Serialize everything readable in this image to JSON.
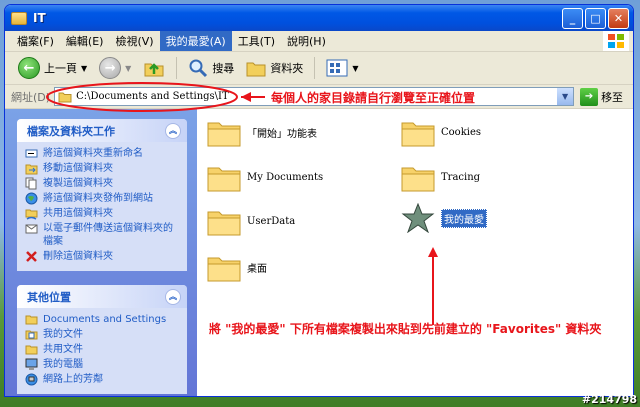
{
  "window": {
    "title": "IT"
  },
  "menu": [
    "檔案(F)",
    "編輯(E)",
    "檢視(V)",
    "我的最愛(A)",
    "工具(T)",
    "說明(H)"
  ],
  "menu_active_index": 3,
  "toolbar": {
    "back_label": "上一頁",
    "search_label": "搜尋",
    "folders_label": "資料夾"
  },
  "address": {
    "label": "網址(D)",
    "path": "C:\\Documents and Settings\\IT",
    "go_label": "移至"
  },
  "tasks_panel": {
    "title": "檔案及資料夾工作",
    "items": [
      {
        "label": "將這個資料夾重新命名",
        "icon": "rename-icon"
      },
      {
        "label": "移動這個資料夾",
        "icon": "move-icon"
      },
      {
        "label": "複製這個資料夾",
        "icon": "copy-icon"
      },
      {
        "label": "將這個資料夾發佈到網站",
        "icon": "globe-icon"
      },
      {
        "label": "共用這個資料夾",
        "icon": "share-icon"
      },
      {
        "label": "以電子郵件傳送這個資料夾的檔案",
        "icon": "email-icon"
      },
      {
        "label": "刪除這個資料夾",
        "icon": "delete-icon"
      }
    ]
  },
  "places_panel": {
    "title": "其他位置",
    "items": [
      {
        "label": "Documents and Settings",
        "icon": "folder-icon"
      },
      {
        "label": "我的文件",
        "icon": "my-documents-icon"
      },
      {
        "label": "共用文件",
        "icon": "shared-documents-icon"
      },
      {
        "label": "我的電腦",
        "icon": "computer-icon"
      },
      {
        "label": "網路上的芳鄰",
        "icon": "network-icon"
      }
    ]
  },
  "files": [
    {
      "name": "「開始」功能表",
      "type": "folder"
    },
    {
      "name": "Cookies",
      "type": "folder"
    },
    {
      "name": "My Documents",
      "type": "folder"
    },
    {
      "name": "Tracing",
      "type": "folder"
    },
    {
      "name": "UserData",
      "type": "folder"
    },
    {
      "name": "我的最愛",
      "type": "favorites"
    },
    {
      "name": "桌面",
      "type": "folder"
    }
  ],
  "annotations": {
    "top": "每個人的家目錄請自行瀏覽至正確位置",
    "bottom": "將 \"我的最愛\" 下所有檔案複製出來貼到先前建立的 \"Favorites\" 資料夾"
  },
  "watermark": "#214798",
  "colors": {
    "annotation": "#e8151b",
    "titlebar": "#0058e6",
    "sidebar": "#6f8fe0",
    "link": "#215dc6"
  }
}
